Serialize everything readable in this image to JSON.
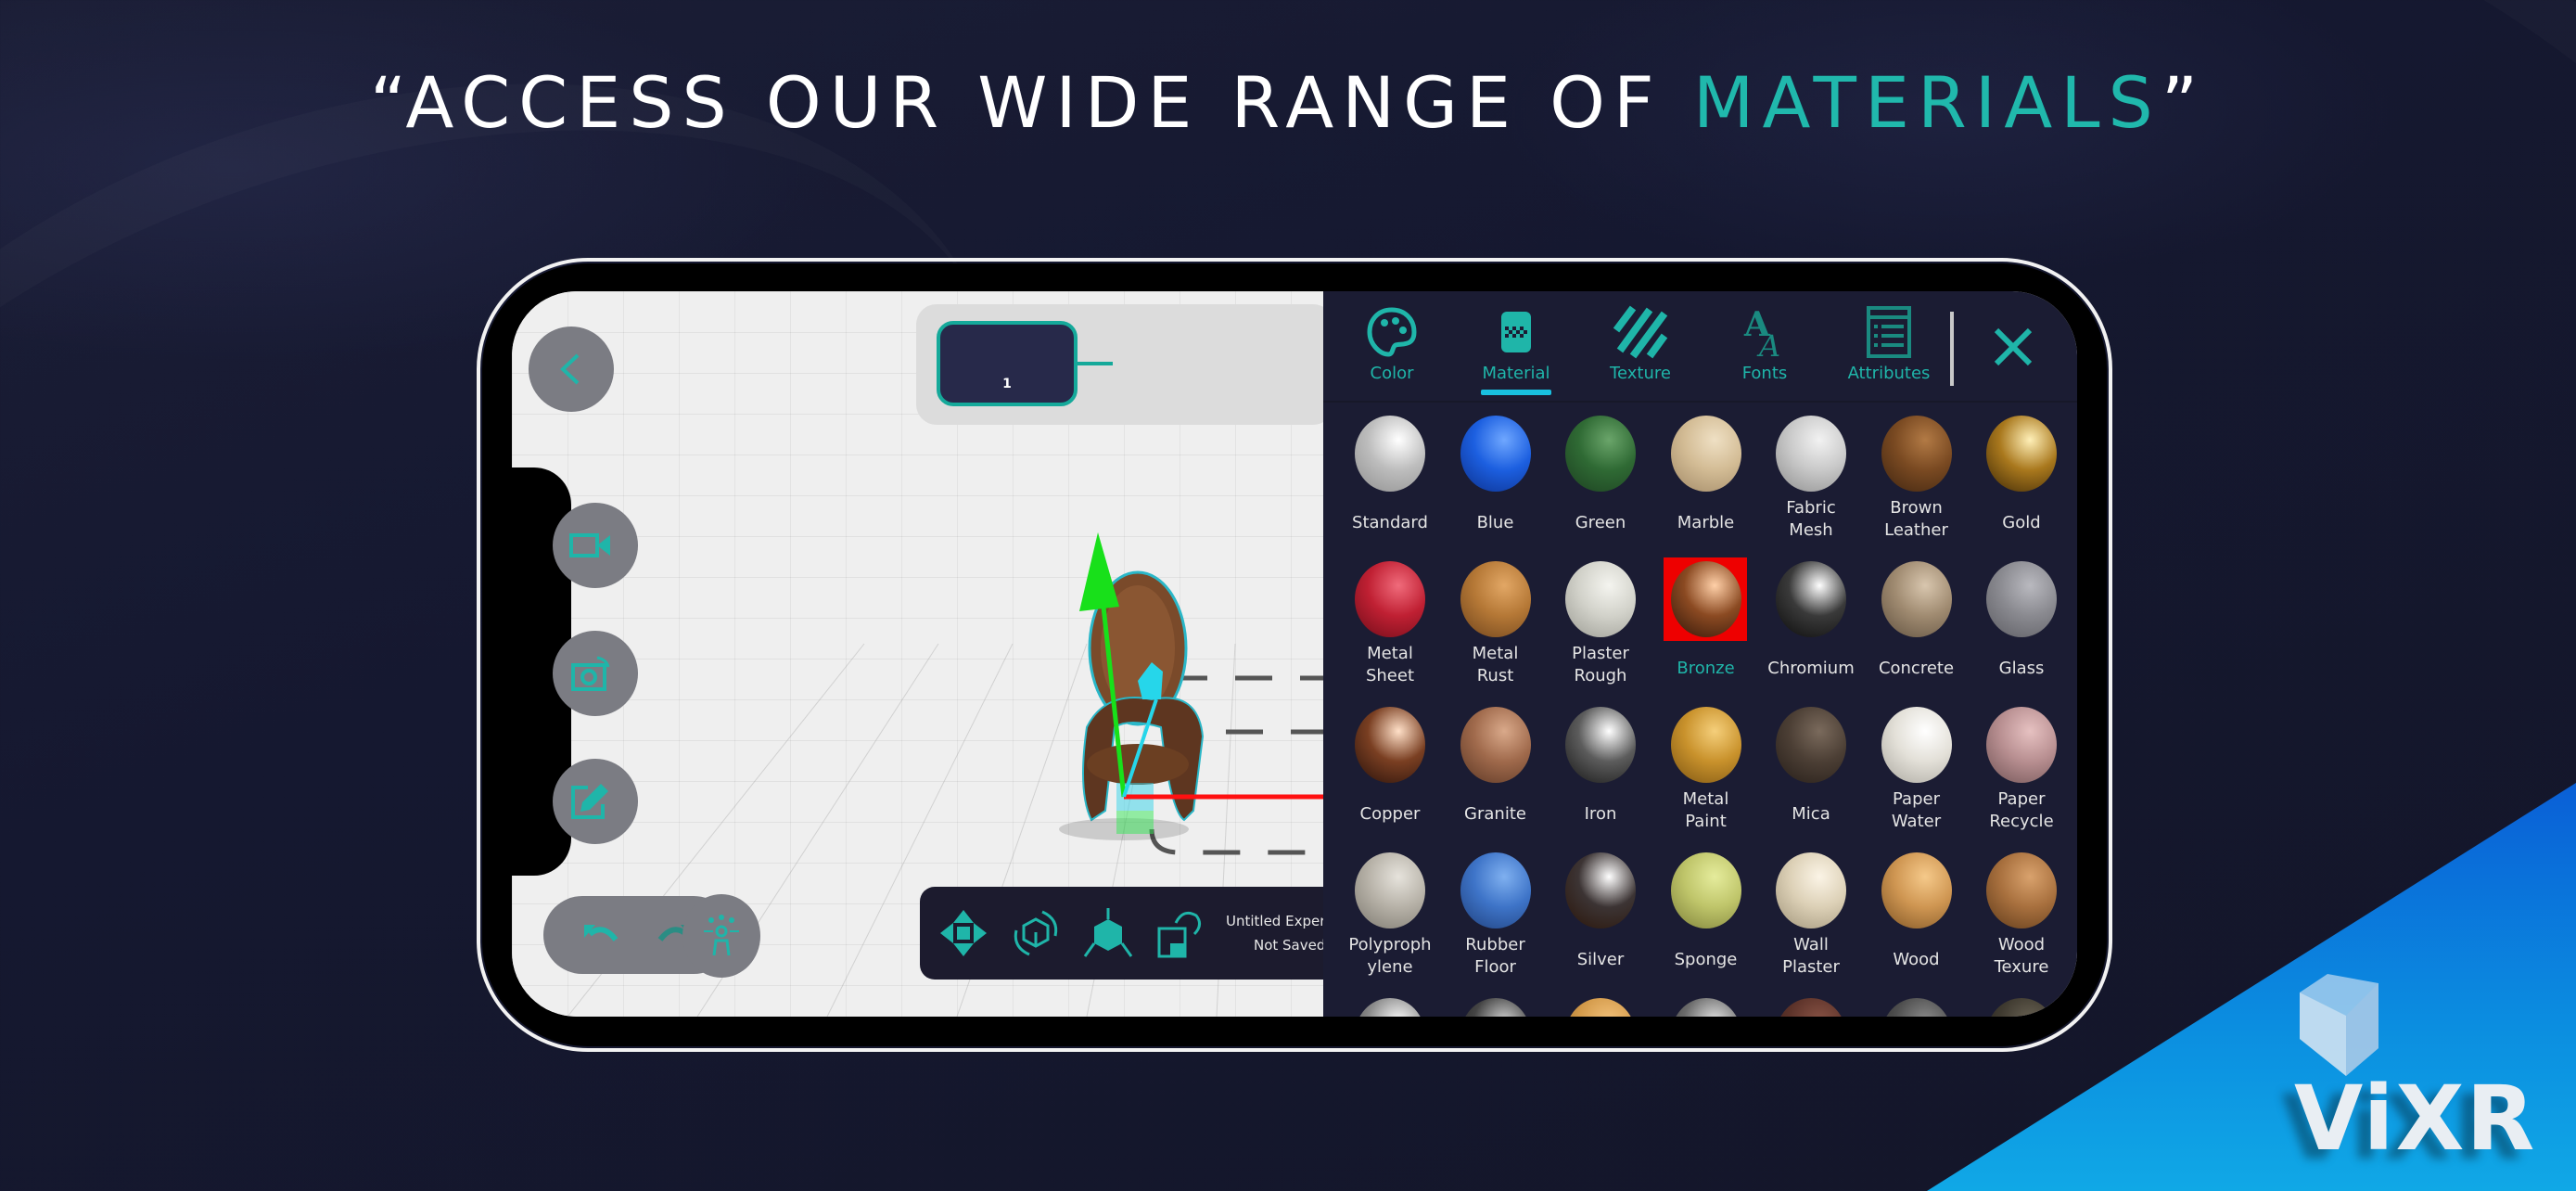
{
  "headline": {
    "prefix": "“ACCESS OUR WIDE RANGE OF ",
    "accent": "MATERIALS",
    "suffix": "”"
  },
  "colors": {
    "accent": "#1fb5a9",
    "background": "#151830",
    "panel": "#1b1c33",
    "selection": "#ee0000",
    "brand_blue": "#0b8ee0"
  },
  "viewport": {
    "back_icon": "chevron-left-icon",
    "side_buttons": [
      {
        "icon": "video-camera-icon"
      },
      {
        "icon": "camera-rotate-icon"
      },
      {
        "icon": "edit-note-icon"
      }
    ],
    "timeline": {
      "node_label": "1"
    },
    "undo_icon": "undo-icon",
    "redo_icon": "redo-icon",
    "hierarchy_icon": "scene-hierarchy-icon",
    "tools": [
      {
        "name": "move",
        "icon": "move-arrows-icon"
      },
      {
        "name": "rotate",
        "icon": "rotate-cube-icon"
      },
      {
        "name": "scale",
        "icon": "scale-cube-icon"
      },
      {
        "name": "reset",
        "icon": "reset-transform-icon"
      }
    ],
    "document": {
      "title": "Untitled Exper",
      "status": "Not Saved"
    }
  },
  "panel": {
    "tabs": [
      {
        "label": "Color",
        "icon": "palette-icon",
        "active": false
      },
      {
        "label": "Material",
        "icon": "material-swatch-icon",
        "active": true
      },
      {
        "label": "Texture",
        "icon": "stripes-texture-icon",
        "active": false
      },
      {
        "label": "Fonts",
        "icon": "fonts-icon",
        "active": false
      },
      {
        "label": "Attributes",
        "icon": "attributes-list-icon",
        "active": false
      }
    ],
    "close_icon": "close-icon",
    "selected_material": "Bronze",
    "materials": [
      {
        "label": "Standard",
        "c1": "#ffffff",
        "c2": "#bdbdbd",
        "c3": "#8e8e8e"
      },
      {
        "label": "Blue",
        "c1": "#6fa7ff",
        "c2": "#1c5fe0",
        "c3": "#0c2f8a"
      },
      {
        "label": "Green",
        "c1": "#6aa56a",
        "c2": "#2f6a34",
        "c3": "#1c3f20"
      },
      {
        "label": "Marble",
        "c1": "#efe0c4",
        "c2": "#d3bc95",
        "c3": "#9f8765"
      },
      {
        "label": "Fabric\nMesh",
        "c1": "#f2f2f2",
        "c2": "#c9c9c9",
        "c3": "#8c8c8c"
      },
      {
        "label": "Brown\nLeather",
        "c1": "#b27a45",
        "c2": "#7a4a22",
        "c3": "#3e2410"
      },
      {
        "label": "Gold",
        "c1": "#fff0b8",
        "c2": "#a9781d",
        "c3": "#3a2606"
      },
      {
        "label": "Metal\nSheet",
        "c1": "#f06b7b",
        "c2": "#c02033",
        "c3": "#6d0c18"
      },
      {
        "label": "Metal\nRust",
        "c1": "#e2a765",
        "c2": "#b57836",
        "c3": "#6d431c"
      },
      {
        "label": "Plaster\nRough",
        "c1": "#f4f4ef",
        "c2": "#d2d2ca",
        "c3": "#9a9a92"
      },
      {
        "label": "Bronze",
        "c1": "#ffd0a8",
        "c2": "#8b4a22",
        "c3": "#2e1408"
      },
      {
        "label": "Chromium",
        "c1": "#ffffff",
        "c2": "#3a3a3a",
        "c3": "#0a0a0a"
      },
      {
        "label": "Concrete",
        "c1": "#d8c6ae",
        "c2": "#a08b71",
        "c3": "#5f503f"
      },
      {
        "label": "Glass",
        "c1": "#b9b9bf",
        "c2": "#8a8a90",
        "c3": "#5c5c62"
      },
      {
        "label": "Copper",
        "c1": "#ffe0c8",
        "c2": "#7a3f22",
        "c3": "#25100a"
      },
      {
        "label": "Granite",
        "c1": "#d9a98a",
        "c2": "#a06a4c",
        "c3": "#5a3624"
      },
      {
        "label": "Iron",
        "c1": "#ffffff",
        "c2": "#5c5c5c",
        "c3": "#151515"
      },
      {
        "label": "Metal\nPaint",
        "c1": "#f5cf7b",
        "c2": "#c9922c",
        "c3": "#7a5312"
      },
      {
        "label": "Mica",
        "c1": "#7a6a5c",
        "c2": "#4c3f35",
        "c3": "#251d18"
      },
      {
        "label": "Paper\nWater",
        "c1": "#ffffff",
        "c2": "#e3e0d8",
        "c3": "#a9a69e"
      },
      {
        "label": "Paper\nRecycle",
        "c1": "#e6c1c1",
        "c2": "#b88f91",
        "c3": "#6f5254"
      },
      {
        "label": "Polyproph\nylene",
        "c1": "#e6e3dc",
        "c2": "#b7b2a8",
        "c3": "#7b776e"
      },
      {
        "label": "Rubber\nFloor",
        "c1": "#7fb0f0",
        "c2": "#3e74c8",
        "c3": "#1f3f7a"
      },
      {
        "label": "Silver",
        "c1": "#ffffff",
        "c2": "#3c3434",
        "c3": "#2a1408"
      },
      {
        "label": "Sponge",
        "c1": "#e5ec9c",
        "c2": "#bfc56a",
        "c3": "#7b7e38"
      },
      {
        "label": "Wall\nPlaster",
        "c1": "#fbf4e6",
        "c2": "#dcd0b6",
        "c3": "#9f9379"
      },
      {
        "label": "Wood",
        "c1": "#f5c98a",
        "c2": "#cf9652",
        "c3": "#7c5324"
      },
      {
        "label": "Wood\nTexure",
        "c1": "#d9a26d",
        "c2": "#a8703e",
        "c3": "#5e3a1a"
      },
      {
        "label": "",
        "c1": "#ffffff",
        "c2": "#8b8b8b",
        "c3": "#2d2d2d"
      },
      {
        "label": "",
        "c1": "#d4d4d4",
        "c2": "#444",
        "c3": "#111"
      },
      {
        "label": "",
        "c1": "#f3c27c",
        "c2": "#d39a4a",
        "c3": "#8b5d20"
      },
      {
        "label": "",
        "c1": "#e6e6e6",
        "c2": "#6c6c6c",
        "c3": "#222"
      },
      {
        "label": "",
        "c1": "#8a5446",
        "c2": "#5d332a",
        "c3": "#2f1813"
      },
      {
        "label": "",
        "c1": "#8e8e8e",
        "c2": "#4e4e4e",
        "c3": "#202020"
      },
      {
        "label": "",
        "c1": "#6b6455",
        "c2": "#3f3a30",
        "c3": "#1b1814"
      }
    ]
  },
  "brand": {
    "logo_text": "ViXR",
    "logo_icon": "vixr-cube-icon"
  }
}
